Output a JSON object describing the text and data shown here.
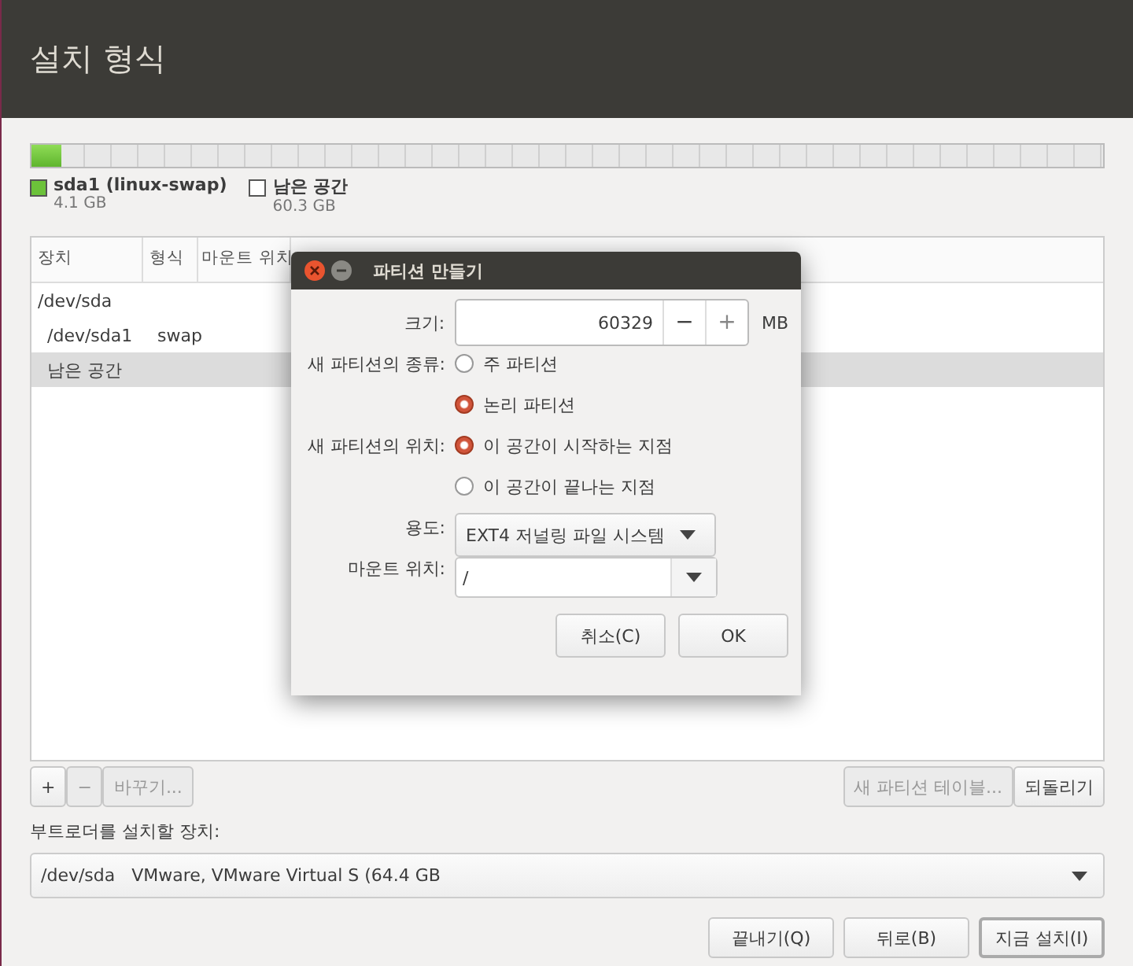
{
  "header": {
    "title": "설치 형식"
  },
  "partition_bar": {
    "level": 0.028
  },
  "legend": [
    {
      "name": "sda1 (linux-swap)",
      "size": "4.1 GB",
      "color": "#6cc23a"
    },
    {
      "name": "남은 공간",
      "size": "60.3 GB",
      "color": "#ffffff"
    }
  ],
  "table": {
    "columns": [
      "장치",
      "형식",
      "마운트 위치"
    ],
    "rows": [
      {
        "device": "/dev/sda",
        "selected": false,
        "children": [
          {
            "device": "/dev/sda1",
            "type": "swap",
            "selected": false
          },
          {
            "device": "남은 공간",
            "selected": true
          }
        ]
      }
    ]
  },
  "table_buttons": [
    {
      "label": "+",
      "disabled": false
    },
    {
      "label": "−",
      "disabled": true
    },
    {
      "label": "바꾸기...",
      "disabled": true
    }
  ],
  "table_buttons_right": [
    {
      "label": "새 파티션 테이블...",
      "disabled": true
    },
    {
      "label": "되돌리기",
      "disabled": false
    }
  ],
  "bootloader": {
    "label": "부트로더를 설치할 장치:",
    "value": "/dev/sda   VMware, VMware Virtual S (64.4 GB"
  },
  "buttons": [
    {
      "label": "끝내기(Q)",
      "focused": false
    },
    {
      "label": "뒤로(B)",
      "focused": false
    },
    {
      "label": "지금 설치(I)",
      "focused": true
    }
  ],
  "dialog": {
    "title": "파티션 만들기",
    "size": {
      "label": "크기:",
      "value": "60329",
      "minus": "−",
      "plus": "+",
      "unit": "MB"
    },
    "type": {
      "label": "새 파티션의 종류:",
      "options": [
        {
          "label": "주 파티션",
          "selected": false
        },
        {
          "label": "논리 파티션",
          "selected": true
        }
      ]
    },
    "location": {
      "label": "새 파티션의 위치:",
      "options": [
        {
          "label": "이 공간이 시작하는 지점",
          "selected": true
        },
        {
          "label": "이 공간이 끝나는 지점",
          "selected": false
        }
      ]
    },
    "use": {
      "label": "용도:",
      "value": "EXT4 저널링 파일 시스템"
    },
    "mount": {
      "label": "마운트 위치:",
      "value": "/"
    },
    "buttons": [
      "취소(C)",
      "OK"
    ]
  }
}
